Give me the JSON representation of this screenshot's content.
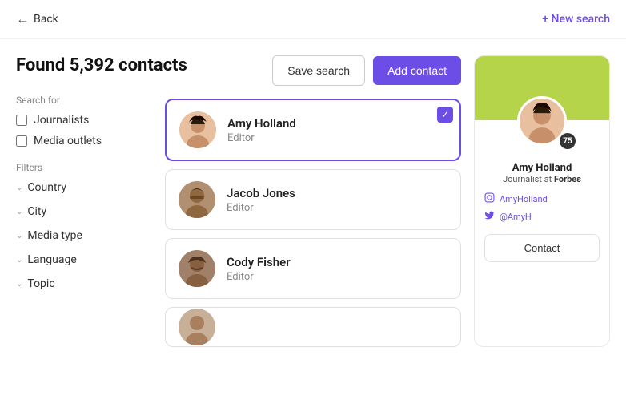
{
  "header": {
    "back_label": "Back",
    "new_search_label": "+ New search"
  },
  "results": {
    "found_title": "Found 5,392 contacts",
    "save_search_label": "Save search",
    "add_contact_label": "Add contact"
  },
  "sidebar": {
    "search_for_label": "Search for",
    "journalists_label": "Journalists",
    "media_outlets_label": "Media outlets",
    "filters_label": "Filters",
    "filters": [
      {
        "id": "country",
        "label": "Country"
      },
      {
        "id": "city",
        "label": "City"
      },
      {
        "id": "media_type",
        "label": "Media type"
      },
      {
        "id": "language",
        "label": "Language"
      },
      {
        "id": "topic",
        "label": "Topic"
      }
    ]
  },
  "contacts": [
    {
      "id": 1,
      "name": "Amy Holland",
      "role": "Editor",
      "selected": true
    },
    {
      "id": 2,
      "name": "Jacob Jones",
      "role": "Editor",
      "selected": false
    },
    {
      "id": 3,
      "name": "Cody Fisher",
      "role": "Editor",
      "selected": false
    },
    {
      "id": 4,
      "name": "",
      "role": "",
      "selected": false
    }
  ],
  "detail": {
    "name": "Amy Holland",
    "role_prefix": "Journalist at",
    "outlet": "Forbes",
    "score": "75",
    "instagram_handle": "AmyHolland",
    "twitter_handle": "@AmyH",
    "contact_btn_label": "Contact"
  }
}
